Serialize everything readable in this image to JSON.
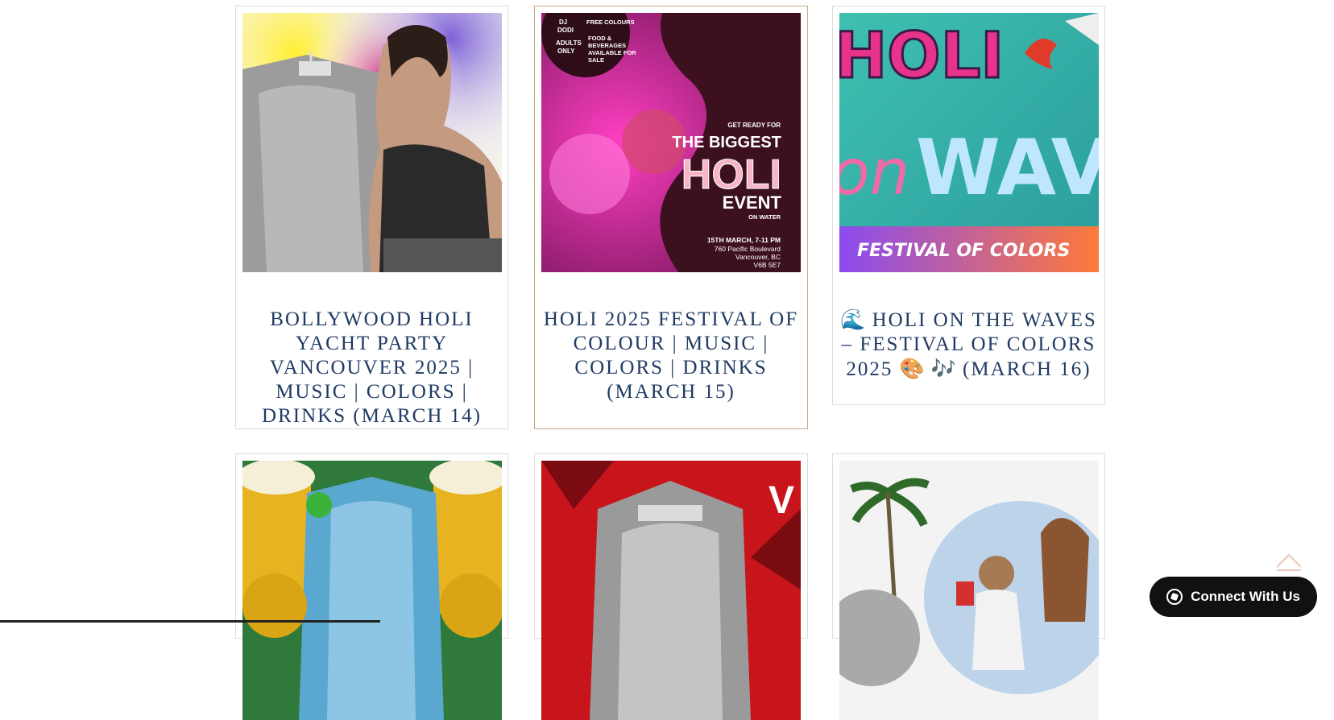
{
  "events": [
    {
      "title": "Bollywood Holi Yacht Party Vancouver 2025 | Music | Colors | Drinks (March 14)"
    },
    {
      "title": "Holi 2025 Festival of Colour | Music | Colors | Drinks (March 15)",
      "poster": {
        "badge_left": [
          "DJ",
          "DODI",
          "ADULTS",
          "ONLY"
        ],
        "badge_right": [
          "FREE COLOURS",
          "FOOD &",
          "BEVERAGES",
          "AVAILABLE FOR",
          "SALE"
        ],
        "pre": "GET READY FOR",
        "line1": "THE BIGGEST",
        "line2": "HOLI",
        "line3": "EVENT",
        "line4": "ON WATER",
        "date": "15TH MARCH, 7-11 PM",
        "addr1": "760 Pacific Boulevard",
        "addr2": "Vancouver, BC",
        "addr3": "V6B 5E7"
      }
    },
    {
      "title_prefix_emoji": "🌊",
      "title": "Holi on the Waves – Festival of Colors 2025",
      "title_suffix_emoji": "🎨 🎶",
      "title_date": "(March 16)",
      "poster": {
        "word1": "HOLI",
        "word2": "on",
        "word3": "WAVE",
        "banner": "FESTIVAL OF COLORS"
      }
    }
  ],
  "connect_button": {
    "label": "Connect With Us",
    "icon": "whatsapp-icon"
  },
  "scroll_top": {
    "icon": "chevron-up-icon"
  },
  "colors": {
    "title": "#1f3a63",
    "active_border": "#c9a98a",
    "button_bg": "#111111"
  }
}
